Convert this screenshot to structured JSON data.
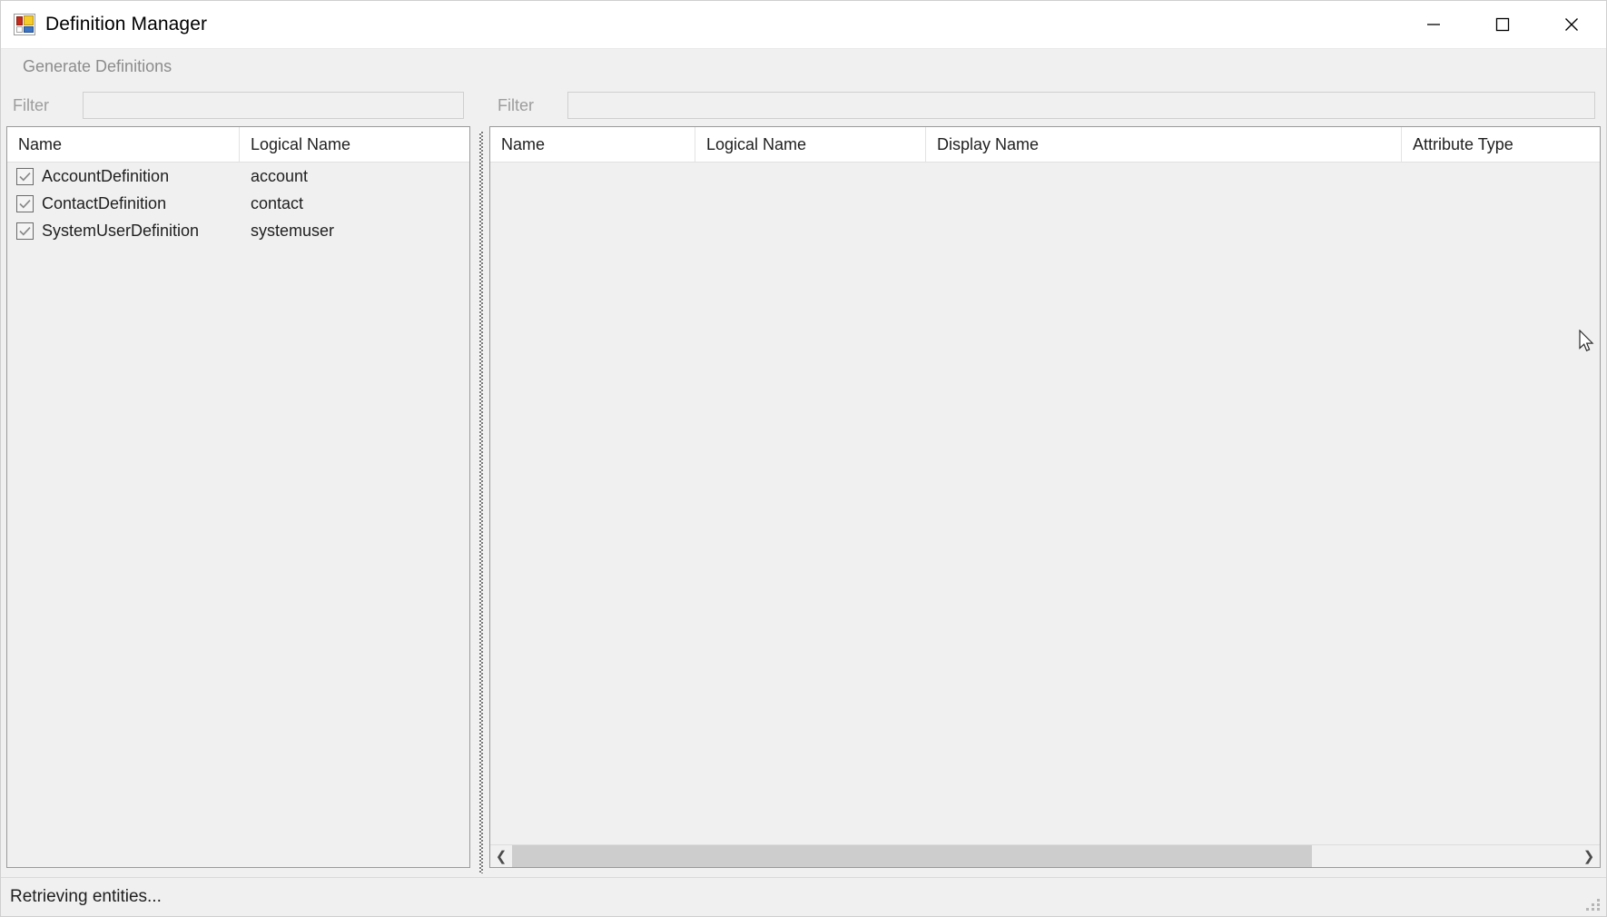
{
  "window": {
    "title": "Definition Manager",
    "icon": "app-grid-icon",
    "controls": {
      "minimize": "minimize-icon",
      "maximize": "maximize-icon",
      "close": "close-icon"
    }
  },
  "menubar": {
    "items": [
      {
        "label": "Generate Definitions",
        "enabled": false
      }
    ]
  },
  "left_panel": {
    "filter": {
      "label": "Filter",
      "value": "",
      "placeholder": "",
      "enabled": false
    },
    "list": {
      "columns": [
        "Name",
        "Logical Name"
      ],
      "rows": [
        {
          "checked": true,
          "name": "AccountDefinition",
          "logical_name": "account"
        },
        {
          "checked": true,
          "name": "ContactDefinition",
          "logical_name": "contact"
        },
        {
          "checked": true,
          "name": "SystemUserDefinition",
          "logical_name": "systemuser"
        }
      ]
    }
  },
  "right_panel": {
    "filter": {
      "label": "Filter",
      "value": "",
      "placeholder": "",
      "enabled": false
    },
    "list": {
      "columns": [
        "Name",
        "Logical Name",
        "Display Name",
        "Attribute Type"
      ],
      "rows": []
    },
    "hscrollbar": {
      "left_arrow": "chevron-left-icon",
      "right_arrow": "chevron-right-icon",
      "thumb_percent": 75
    }
  },
  "statusbar": {
    "message": "Retrieving entities...",
    "grip": "resize-grip-icon"
  },
  "colors": {
    "window_bg": "#f0f0f0",
    "titlebar_bg": "#ffffff",
    "list_bg": "#f0f0f0",
    "header_bg": "#ffffff",
    "border": "#9a9a9a",
    "disabled_text": "#9d9d9d",
    "text": "#1f1f1f",
    "scroll_thumb": "#cdcdcd"
  }
}
